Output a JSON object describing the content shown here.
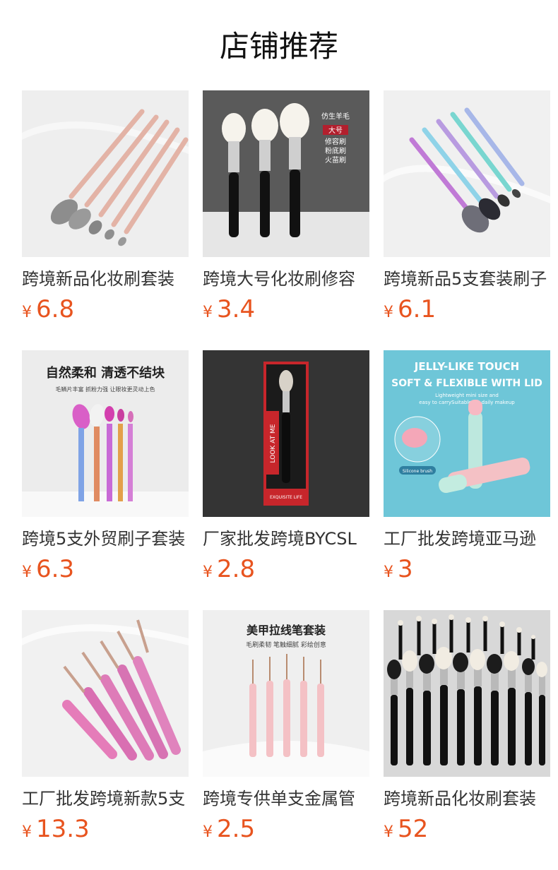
{
  "header": {
    "title": "店铺推荐"
  },
  "colors": {
    "price": "#e8541f"
  },
  "products": [
    {
      "name": "跨境新品化妆刷套装",
      "currency": "¥",
      "price": "6.8",
      "image_texts": []
    },
    {
      "name": "跨境大号化妆刷修容",
      "currency": "¥",
      "price": "3.4",
      "image_texts": [
        "仿生羊毛",
        "大号",
        "修容刷",
        "粉底刷",
        "火苗刷"
      ]
    },
    {
      "name": "跨境新品5支套装刷子",
      "currency": "¥",
      "price": "6.1",
      "image_texts": []
    },
    {
      "name": "跨境5支外贸刷子套装",
      "currency": "¥",
      "price": "6.3",
      "image_texts": [
        "自然柔和 清透不结块",
        "毛鳞片丰富 抓粉力强 让眼妆更灵动上色"
      ]
    },
    {
      "name": "厂家批发跨境BYCSL",
      "currency": "¥",
      "price": "2.8",
      "image_texts": [
        "LOOK AT ME",
        "EXQUISITE LIFE"
      ]
    },
    {
      "name": "工厂批发跨境亚马逊",
      "currency": "¥",
      "price": "3",
      "image_texts": [
        "JELLY-LIKE TOUCH",
        "SOFT & FLEXIBLE WITH LID",
        "Lightweight mini size and",
        "easy to carrySuitable for daily makeup",
        "Silicone brush"
      ]
    },
    {
      "name": "工厂批发跨境新款5支",
      "currency": "¥",
      "price": "13.3",
      "image_texts": []
    },
    {
      "name": "跨境专供单支金属管",
      "currency": "¥",
      "price": "2.5",
      "image_texts": [
        "美甲拉线笔套装",
        "毛刷柔韧 笔触细腻 彩绘创意"
      ]
    },
    {
      "name": "跨境新品化妆刷套装",
      "currency": "¥",
      "price": "52",
      "image_texts": []
    }
  ]
}
